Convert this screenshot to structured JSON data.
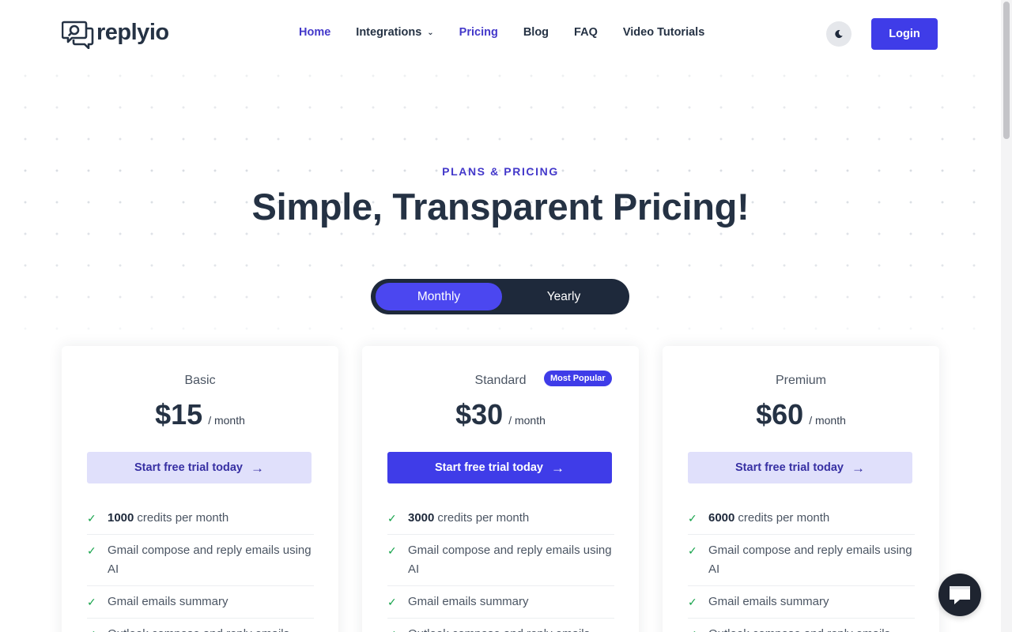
{
  "brand": {
    "logo_text": "replyio"
  },
  "nav": {
    "items": [
      {
        "label": "Home",
        "active": true,
        "has_dropdown": false
      },
      {
        "label": "Integrations",
        "active": false,
        "has_dropdown": true
      },
      {
        "label": "Pricing",
        "active": true,
        "has_dropdown": false
      },
      {
        "label": "Blog",
        "active": false,
        "has_dropdown": false
      },
      {
        "label": "FAQ",
        "active": false,
        "has_dropdown": false
      },
      {
        "label": "Video Tutorials",
        "active": false,
        "has_dropdown": false
      }
    ],
    "theme_toggle_icon": "moon-icon",
    "login_label": "Login"
  },
  "hero": {
    "eyebrow": "PLANS & PRICING",
    "title": "Simple, Transparent Pricing!"
  },
  "billing_toggle": {
    "options": [
      "Monthly",
      "Yearly"
    ],
    "selected": "Monthly"
  },
  "plans": [
    {
      "name": "Basic",
      "price": "$15",
      "period": "/ month",
      "cta": "Start free trial today",
      "cta_style": "light",
      "badge": "",
      "features": [
        {
          "bold": "1000",
          "text": "credits per month"
        },
        {
          "bold": "",
          "text": "Gmail compose and reply emails using AI"
        },
        {
          "bold": "",
          "text": "Gmail emails summary"
        },
        {
          "bold": "",
          "text": "Outlook compose and reply emails"
        }
      ]
    },
    {
      "name": "Standard",
      "price": "$30",
      "period": "/ month",
      "cta": "Start free trial today",
      "cta_style": "dark",
      "badge": "Most Popular",
      "features": [
        {
          "bold": "3000",
          "text": "credits per month"
        },
        {
          "bold": "",
          "text": "Gmail compose and reply emails using AI"
        },
        {
          "bold": "",
          "text": "Gmail emails summary"
        },
        {
          "bold": "",
          "text": "Outlook compose and reply emails"
        }
      ]
    },
    {
      "name": "Premium",
      "price": "$60",
      "period": "/ month",
      "cta": "Start free trial today",
      "cta_style": "light",
      "badge": "",
      "features": [
        {
          "bold": "6000",
          "text": "credits per month"
        },
        {
          "bold": "",
          "text": "Gmail compose and reply emails using AI"
        },
        {
          "bold": "",
          "text": "Gmail emails summary"
        },
        {
          "bold": "",
          "text": "Outlook compose and reply emails"
        }
      ]
    }
  ],
  "colors": {
    "accent": "#3f3ce8",
    "accent_light": "#e0e0fb",
    "heading": "#253244",
    "check": "#15a34a",
    "toggle_bg": "#1e293b"
  },
  "icons": {
    "cta_arrow": "arrow-right-icon",
    "feature_check": "check-icon",
    "chat": "chat-icon"
  }
}
